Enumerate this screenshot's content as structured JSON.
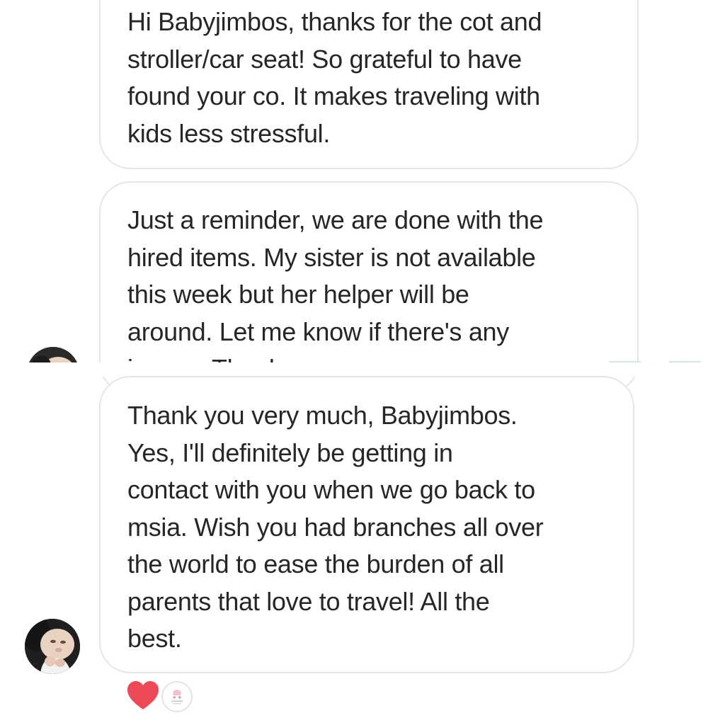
{
  "messages": [
    {
      "text": "Hi Babyjimbos, thanks for the cot and\nstroller/car seat! So grateful to have\nfound your co. It makes traveling with\nkids less stressful."
    },
    {
      "text": "Just a reminder, we are done with the\nhired items. My sister is not available\nthis week but her helper will be\naround. Let me know if there's any\nissues. Thanks"
    },
    {
      "text": "Thank you very much, Babyjimbos.\nYes, I'll definitely be getting in\ncontact with you when we go back to\nmsia. Wish you had branches all over\nthe world to ease the burden of all\nparents that love to travel! All the\nbest."
    }
  ],
  "reactions": {
    "icon": "heart-icon",
    "color": "#ed4956"
  },
  "colors": {
    "bubble_border": "#e6e6e6",
    "text": "#262626",
    "background": "#ffffff"
  }
}
